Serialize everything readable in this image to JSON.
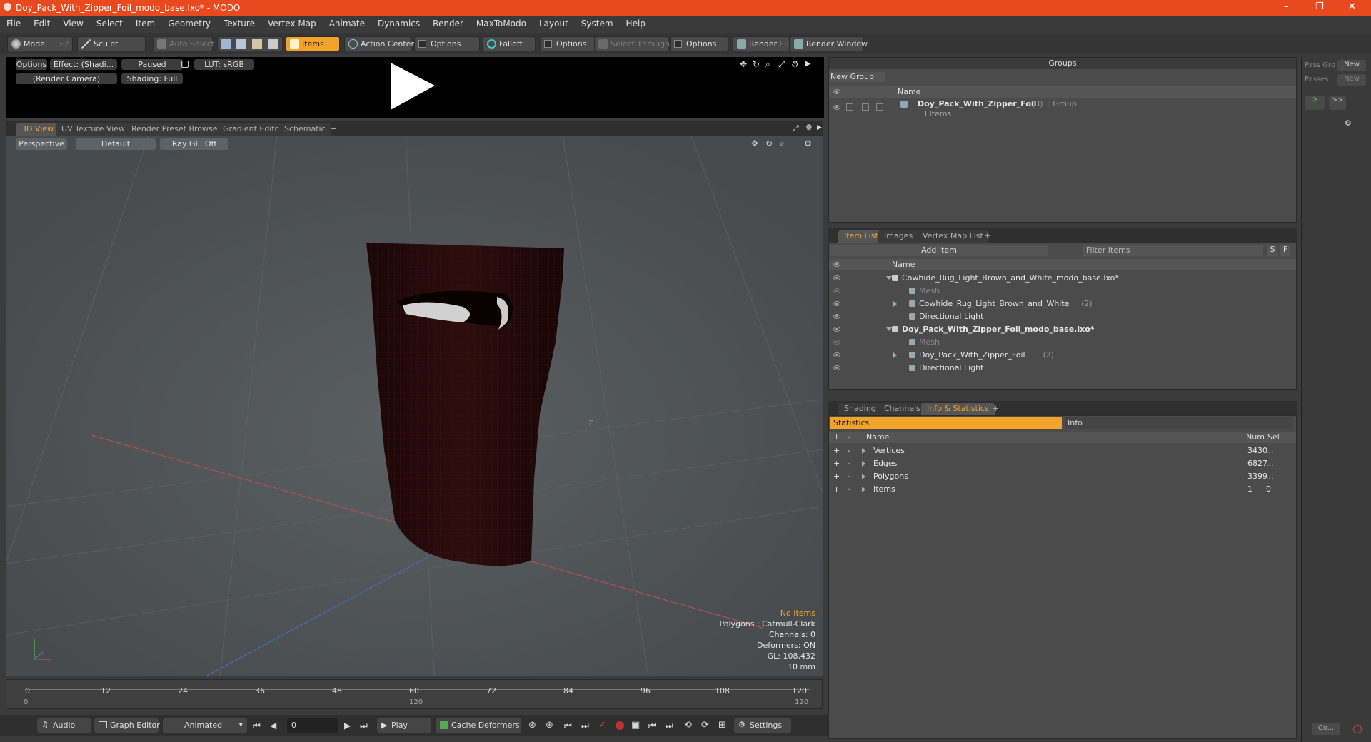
{
  "window": {
    "title": "Doy_Pack_With_Zipper_Foil_modo_base.lxo* - MODO",
    "controls": {
      "minimize": "–",
      "restore": "❐",
      "close": "✕"
    }
  },
  "menu": [
    "File",
    "Edit",
    "View",
    "Select",
    "Item",
    "Geometry",
    "Texture",
    "Vertex Map",
    "Animate",
    "Dynamics",
    "Render",
    "MaxToModo",
    "Layout",
    "System",
    "Help"
  ],
  "toolbar": {
    "model": "Model",
    "model_key": "F2",
    "sculpt": "Sculpt",
    "auto_select": "Auto Select",
    "items": "Items",
    "action_center": "Action Center",
    "options1": "Options",
    "falloff": "Falloff",
    "options2": "Options",
    "select_through": "Select Through",
    "options3": "Options",
    "render": "Render",
    "render_key": "F9",
    "render_window": "Render Window"
  },
  "preview": {
    "options": "Options",
    "effect": "Effect: (Shadi...",
    "paused": "Paused",
    "lut": "LUT: sRGB",
    "camera": "(Render Camera)",
    "shading": "Shading: Full"
  },
  "viewport_tabs": [
    "3D View",
    "UV Texture View",
    "Render Preset Browser",
    "Gradient Editor",
    "Schematic",
    "+"
  ],
  "viewport": {
    "perspective": "Perspective",
    "default": "Default",
    "raygl": "Ray GL: Off",
    "axis_label": "Z",
    "overlay": {
      "no_items": "No Items",
      "polygons": "Polygons : Catmull-Clark",
      "channels": "Channels: 0",
      "deformers": "Deformers: ON",
      "gl": "GL: 108,432",
      "unit": "10 mm"
    }
  },
  "timeline": {
    "ticks": [
      "0",
      "12",
      "24",
      "36",
      "48",
      "60",
      "72",
      "84",
      "96",
      "108",
      "120"
    ],
    "lower": [
      "0",
      "120",
      "120"
    ]
  },
  "bottom": {
    "audio": "Audio",
    "graph_editor": "Graph Editor",
    "animated": "Animated",
    "frame": "0",
    "play": "Play",
    "cache_deformers": "Cache Deformers",
    "settings": "Settings"
  },
  "groups": {
    "title": "Groups",
    "new_group": "New Group",
    "col_name": "Name",
    "row_name": "Doy_Pack_With_Zipper_Foil",
    "row_count": "(3)",
    "row_type": ": Group",
    "row_sub": "3 Items"
  },
  "item_tabs": [
    "Item List",
    "Images",
    "Vertex Map List",
    "+"
  ],
  "item_list": {
    "add_item": "Add Item",
    "filter": "Filter Items",
    "s": "S",
    "f": "F",
    "col_name": "Name",
    "rows": [
      {
        "label": "Cowhide_Rug_Light_Brown_and_White_modo_base.lxo*",
        "dim": false,
        "bold": false
      },
      {
        "label": "Mesh",
        "dim": true,
        "bold": false
      },
      {
        "label": "Cowhide_Rug_Light_Brown_and_White",
        "count": "(2)",
        "dim": false,
        "bold": false
      },
      {
        "label": "Directional Light",
        "dim": false,
        "bold": false
      },
      {
        "label": "Doy_Pack_With_Zipper_Foil_modo_base.lxo*",
        "dim": false,
        "bold": true
      },
      {
        "label": "Mesh",
        "dim": true,
        "bold": false
      },
      {
        "label": "Doy_Pack_With_Zipper_Foil",
        "count": "(2)",
        "dim": false,
        "bold": false
      },
      {
        "label": "Directional Light",
        "dim": false,
        "bold": false
      }
    ]
  },
  "info_tabs": [
    "Shading",
    "Channels",
    "Info & Statistics",
    "+"
  ],
  "stats": {
    "tab_statistics": "Statistics",
    "tab_info": "Info",
    "col_name": "Name",
    "col_num": "Num",
    "col_sel": "Sel",
    "rows": [
      {
        "name": "Vertices",
        "num": "3430",
        "sel": "..."
      },
      {
        "name": "Edges",
        "num": "6827",
        "sel": "..."
      },
      {
        "name": "Polygons",
        "num": "3399",
        "sel": "..."
      },
      {
        "name": "Items",
        "num": "1",
        "sel": "0"
      }
    ]
  },
  "right_strip": {
    "pass_gro": "Pass Gro",
    "new1": "New",
    "passes": "Passes",
    "new2": "New",
    "more": ">>",
    "co": "Co..."
  },
  "colors": {
    "accent": "#f2a32a",
    "title": "#e8491e",
    "viewport": "#4f5457",
    "bag": "#2a0c0c"
  }
}
